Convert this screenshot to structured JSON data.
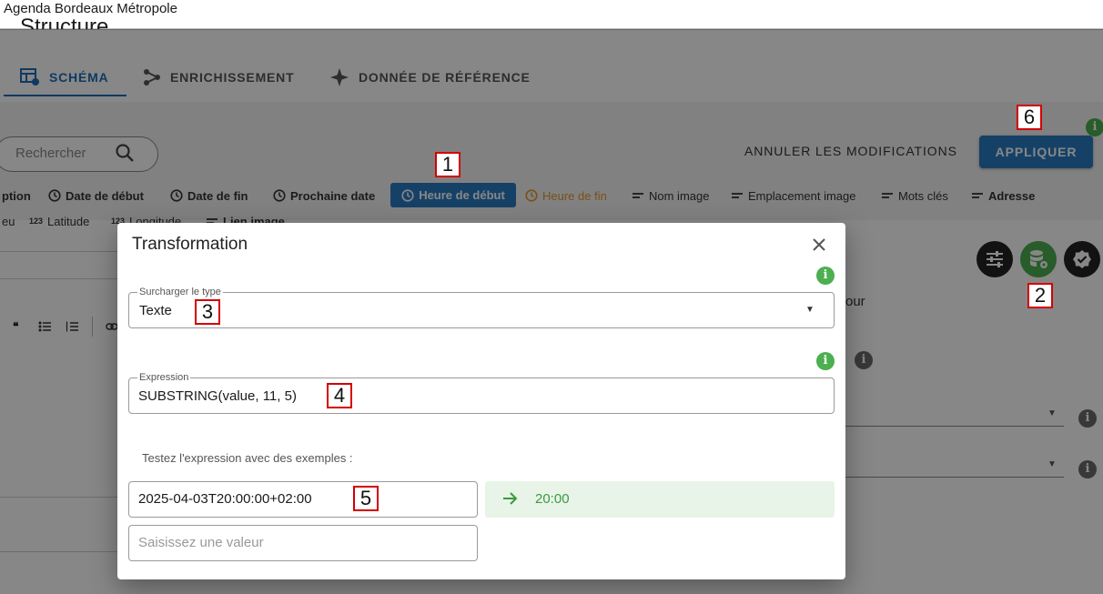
{
  "app": {
    "title": "Agenda Bordeaux Métropole",
    "page_heading": "Structure"
  },
  "tabs": [
    {
      "label": "SCHÉMA",
      "active": true,
      "icon": "schema-icon"
    },
    {
      "label": "ENRICHISSEMENT",
      "active": false,
      "icon": "graph-icon"
    },
    {
      "label": "DONNÉE DE RÉFÉRENCE",
      "active": false,
      "icon": "sparkle-icon"
    }
  ],
  "search": {
    "placeholder": "Rechercher"
  },
  "actions": {
    "cancel_label": "ANNULER LES MODIFICATIONS",
    "apply_label": "APPLIQUER"
  },
  "field_chips": [
    {
      "label": "ption",
      "icon": ""
    },
    {
      "label": "Date de début",
      "icon": "clock-icon"
    },
    {
      "label": "Date de fin",
      "icon": "clock-icon"
    },
    {
      "label": "Prochaine date",
      "icon": "clock-icon"
    },
    {
      "label": "Heure de début",
      "icon": "clock-icon",
      "selected": true
    },
    {
      "label": "Heure de fin",
      "icon": "clock-icon",
      "color": "#e39a2e"
    },
    {
      "label": "Nom image",
      "icon": "text-icon"
    },
    {
      "label": "Emplacement image",
      "icon": "text-icon"
    },
    {
      "label": "Mots clés",
      "icon": "text-icon"
    },
    {
      "label": "Adresse",
      "icon": "text-icon"
    }
  ],
  "field_chips_row2": [
    {
      "label": "eu",
      "icon": ""
    },
    {
      "label": "Latitude",
      "icon": "number-icon"
    },
    {
      "label": "Longitude",
      "icon": "number-icon"
    },
    {
      "label": "Lien image",
      "icon": "text-icon"
    }
  ],
  "background_fragment": "our",
  "number_icon_text": "123",
  "dialog": {
    "title": "Transformation",
    "type_override": {
      "label": "Surcharger le type",
      "value": "Texte"
    },
    "expression": {
      "label": "Expression",
      "value": "SUBSTRING(value, 11, 5)"
    },
    "examples_label": "Testez l'expression avec des exemples :",
    "example_input": "2025-04-03T20:00:00+02:00",
    "example_result": "20:00",
    "new_example_placeholder": "Saisissez une valeur",
    "info_glyph": "i"
  },
  "annotations": [
    "1",
    "2",
    "3",
    "4",
    "5",
    "6"
  ],
  "colors": {
    "primary": "#2a7cc2",
    "success": "#4caf50",
    "warning": "#e39a2e",
    "result_bg": "#e8f4e8"
  }
}
